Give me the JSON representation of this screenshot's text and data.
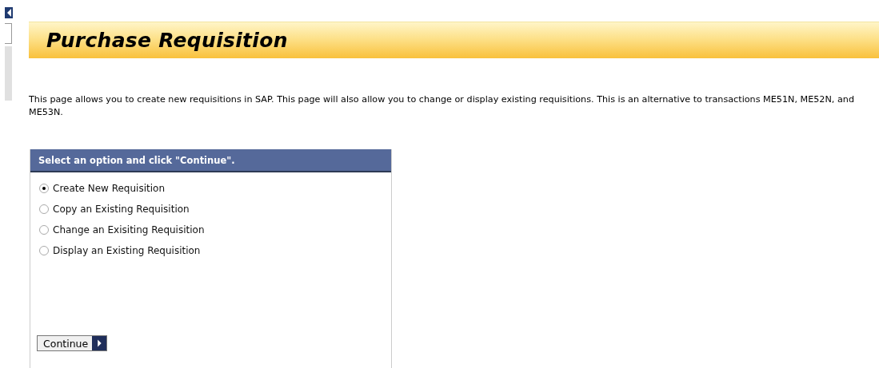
{
  "title": "Purchase Requisition",
  "intro": "This page allows you to create new requisitions in SAP.  This page will also allow you to change or display existing requisitions.  This is an alternative to transactions ME51N, ME52N, and ME53N.",
  "panel": {
    "title": "Select an option and click \"Continue\".",
    "options": [
      {
        "label": "Create New Requisition",
        "selected": true
      },
      {
        "label": "Copy an Existing Requisition",
        "selected": false
      },
      {
        "label": "Change an Exisiting Requisition",
        "selected": false
      },
      {
        "label": "Display an Existing Requisition",
        "selected": false
      }
    ],
    "button": "Continue"
  }
}
